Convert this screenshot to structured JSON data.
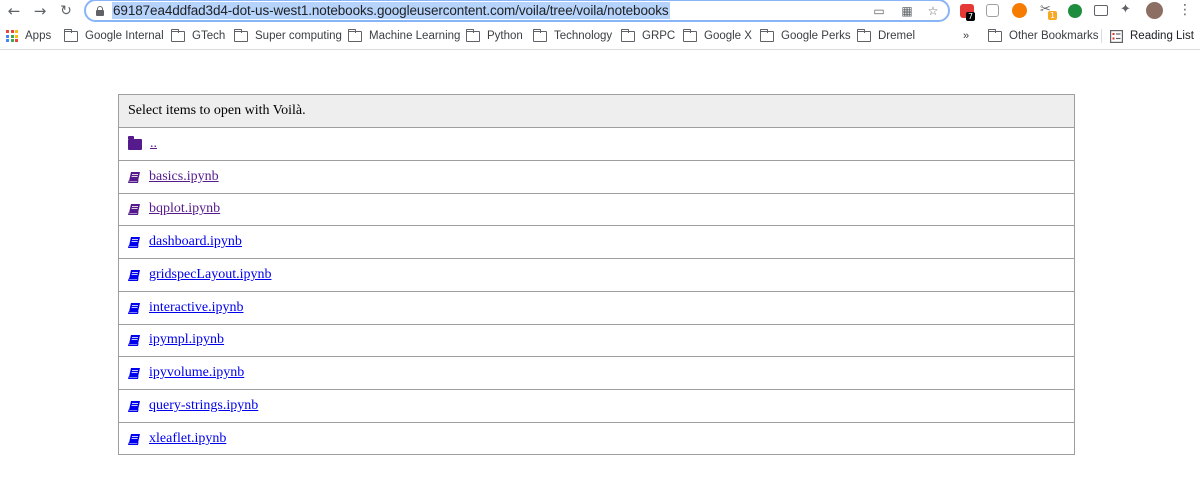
{
  "browser": {
    "url": "69187ea4ddfad3d4-dot-us-west1.notebooks.googleusercontent.com/voila/tree/voila/notebooks",
    "extensions": {
      "ext1_badge": "7",
      "ext4_badge": "1"
    }
  },
  "bookmarks": [
    {
      "label": "Apps",
      "icon": "apps-grid-icon"
    },
    {
      "label": "Google Internal",
      "icon": "folder-icon"
    },
    {
      "label": "GTech",
      "icon": "folder-icon"
    },
    {
      "label": "Super computing",
      "icon": "folder-icon"
    },
    {
      "label": "Machine Learning",
      "icon": "folder-icon"
    },
    {
      "label": "Python",
      "icon": "folder-icon"
    },
    {
      "label": "Technology",
      "icon": "folder-icon"
    },
    {
      "label": "GRPC",
      "icon": "folder-icon"
    },
    {
      "label": "Google X",
      "icon": "folder-icon"
    },
    {
      "label": "Google Perks",
      "icon": "folder-icon"
    },
    {
      "label": "Dremel",
      "icon": "folder-icon"
    }
  ],
  "bookmarks_overflow": "»",
  "other_bookmarks": "Other Bookmarks",
  "reading_list": "Reading List",
  "listing": {
    "header": "Select items to open with Voilà.",
    "items": [
      {
        "name": "..",
        "type": "folder",
        "visited": true
      },
      {
        "name": "basics.ipynb",
        "type": "notebook",
        "visited": true
      },
      {
        "name": "bqplot.ipynb",
        "type": "notebook",
        "visited": true
      },
      {
        "name": "dashboard.ipynb",
        "type": "notebook",
        "visited": false
      },
      {
        "name": "gridspecLayout.ipynb",
        "type": "notebook",
        "visited": false
      },
      {
        "name": "interactive.ipynb",
        "type": "notebook",
        "visited": false
      },
      {
        "name": "ipympl.ipynb",
        "type": "notebook",
        "visited": false
      },
      {
        "name": "ipyvolume.ipynb",
        "type": "notebook",
        "visited": false
      },
      {
        "name": "query-strings.ipynb",
        "type": "notebook",
        "visited": false
      },
      {
        "name": "xleaflet.ipynb",
        "type": "notebook",
        "visited": false
      }
    ]
  },
  "colors": {
    "link": "#0000ee",
    "visited": "#551a8b",
    "header_bg": "#eeeeee",
    "border": "#9e9e9e"
  }
}
